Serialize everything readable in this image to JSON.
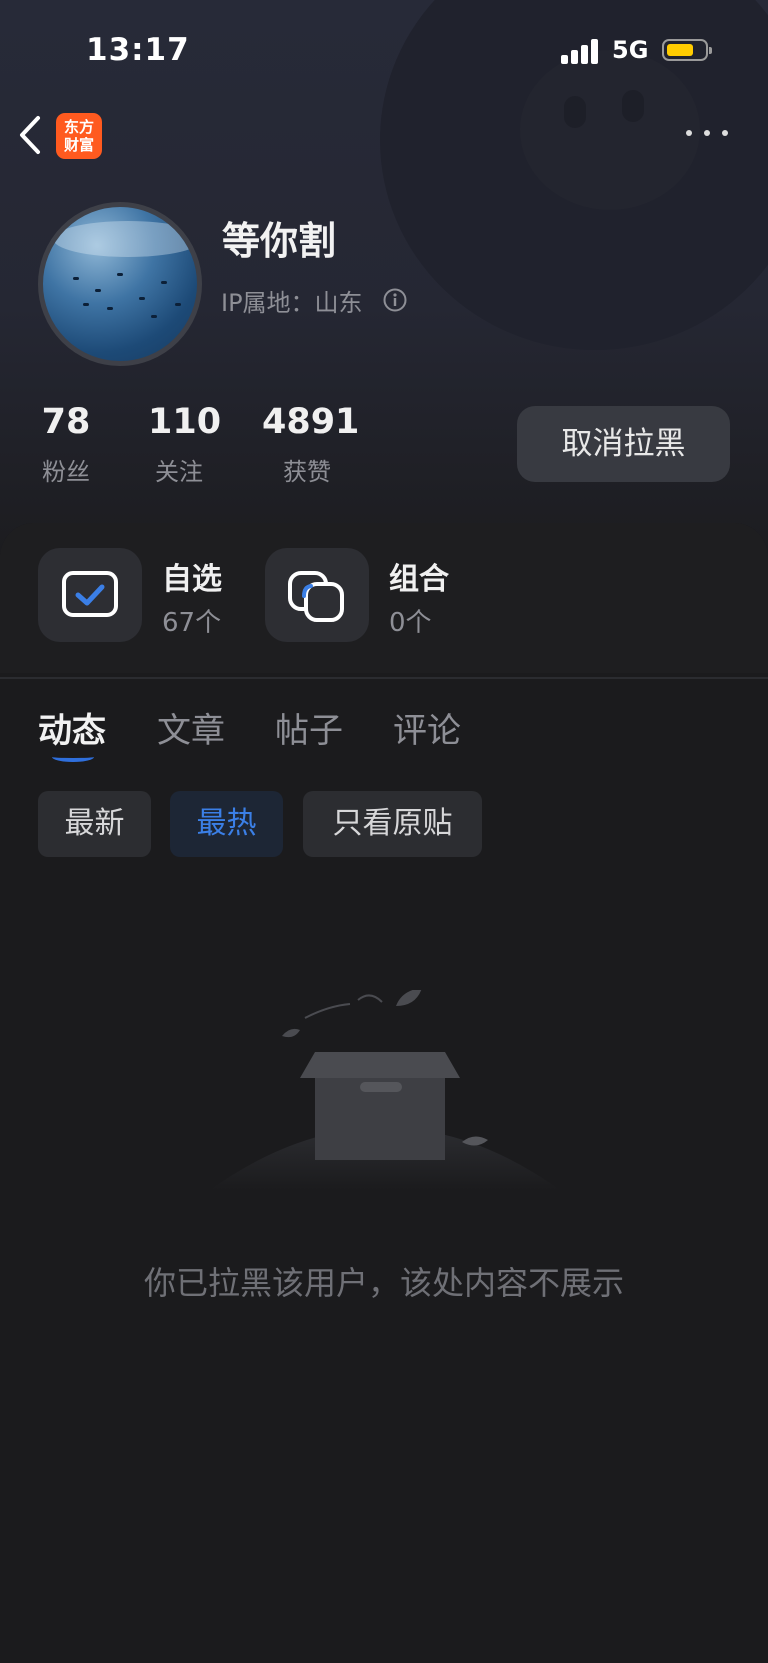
{
  "status_bar": {
    "time": "13:17",
    "network": "5G"
  },
  "nav": {
    "logo_text": [
      "东方",
      "财富"
    ]
  },
  "profile": {
    "name": "等你割",
    "ip_location": "IP属地：山东"
  },
  "stats": [
    {
      "value": "78",
      "label": "粉丝"
    },
    {
      "value": "110",
      "label": "关注"
    },
    {
      "value": "4891",
      "label": "获赞"
    }
  ],
  "unblock_button": "取消拉黑",
  "quick_links": [
    {
      "title": "自选",
      "sub": "67个"
    },
    {
      "title": "组合",
      "sub": "0个"
    }
  ],
  "tabs": [
    {
      "label": "动态",
      "active": true
    },
    {
      "label": "文章",
      "active": false
    },
    {
      "label": "帖子",
      "active": false
    },
    {
      "label": "评论",
      "active": false
    }
  ],
  "filters": [
    {
      "label": "最新",
      "active": false
    },
    {
      "label": "最热",
      "active": true
    },
    {
      "label": "只看原贴",
      "active": false
    }
  ],
  "empty_message": "你已拉黑该用户，该处内容不展示",
  "colors": {
    "accent": "#2f6fdc",
    "logo": "#ff5a1f",
    "battery": "#ffcc00"
  }
}
